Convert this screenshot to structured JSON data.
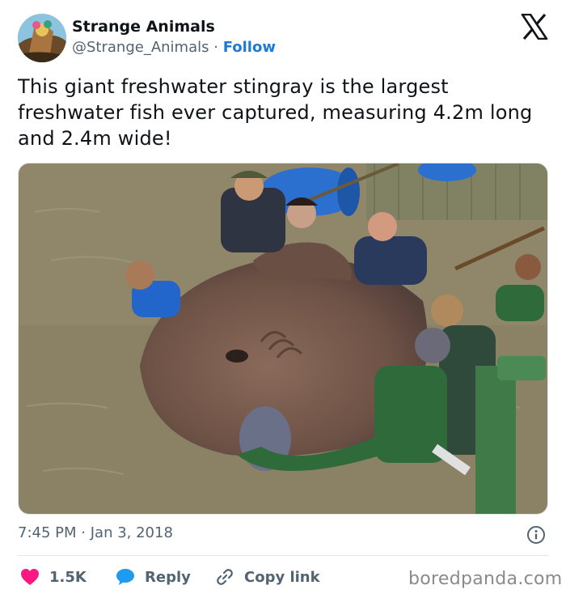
{
  "author": {
    "name": "Strange Animals",
    "handle": "@Strange_Animals",
    "separator": "·",
    "follow_label": "Follow"
  },
  "post": {
    "text": "This giant freshwater stingray is the largest freshwater fish ever captured, measuring 4.2m long and 2.4m wide!",
    "time": "7:45 PM",
    "date_separator": "·",
    "date": "Jan 3, 2018"
  },
  "icons": {
    "brand": "x-logo-icon",
    "info": "info-icon",
    "like": "heart-icon",
    "reply": "speech-bubble-icon",
    "copy": "link-icon"
  },
  "actions": {
    "likes": "1.5K",
    "reply_label": "Reply",
    "copy_label": "Copy link"
  },
  "colors": {
    "like": "#f91880",
    "reply": "#1d9bf0",
    "follow": "#1d7ad8",
    "secondary_text": "#536471"
  },
  "watermark": "boredpanda.com"
}
